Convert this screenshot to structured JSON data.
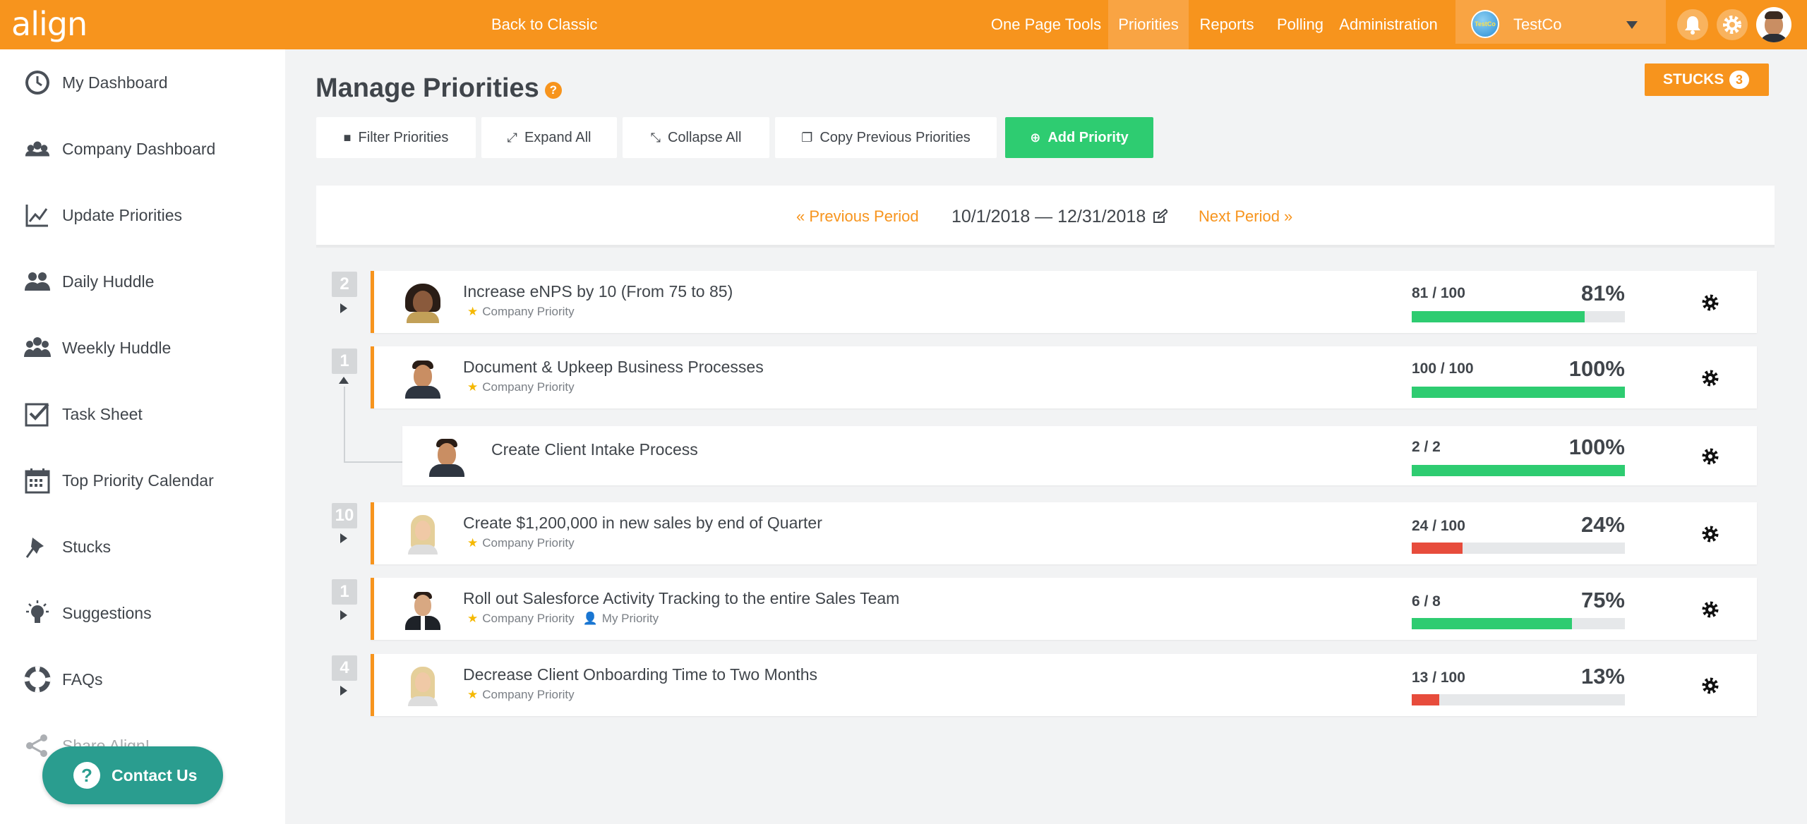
{
  "header": {
    "logo": "align",
    "back_to_classic": "Back to Classic",
    "nav": [
      "One Page Tools",
      "Priorities",
      "Reports",
      "Polling",
      "Administration"
    ],
    "active_nav": "Priorities",
    "company_logo_text": "TestCo",
    "company_name": "TestCo",
    "accent_color": "#f7941d"
  },
  "sidebar": {
    "items": [
      {
        "label": "My Dashboard",
        "icon": "dashboard-clock-icon"
      },
      {
        "label": "Company Dashboard",
        "icon": "team-icon"
      },
      {
        "label": "Update Priorities",
        "icon": "line-chart-icon"
      },
      {
        "label": "Daily Huddle",
        "icon": "group-icon"
      },
      {
        "label": "Weekly Huddle",
        "icon": "large-group-icon"
      },
      {
        "label": "Task Sheet",
        "icon": "checkbox-icon"
      },
      {
        "label": "Top Priority Calendar",
        "icon": "calendar-icon"
      },
      {
        "label": "Stucks",
        "icon": "pin-icon"
      },
      {
        "label": "Suggestions",
        "icon": "lightbulb-icon"
      },
      {
        "label": "FAQs",
        "icon": "lifebuoy-icon"
      },
      {
        "label": "Share Align!",
        "icon": "share-icon"
      }
    ],
    "contact_us": "Contact Us"
  },
  "main": {
    "title": "Manage Priorities",
    "help": "?",
    "stucks_label": "STUCKS",
    "stucks_count": "3",
    "toolbar": {
      "filter": "Filter Priorities",
      "expand": "Expand All",
      "collapse": "Collapse All",
      "copy": "Copy Previous Priorities",
      "add": "Add Priority"
    },
    "period": {
      "prev": "« Previous Period",
      "range": "10/1/2018 — 12/31/2018",
      "next": "Next Period »"
    },
    "priorities": [
      {
        "badge": "2",
        "title": "Increase eNPS by 10 (From 75 to 85)",
        "tag": "Company Priority",
        "tag2": "",
        "ratio": "81 / 100",
        "pct": "81%",
        "progress": 0.81,
        "status": "green"
      },
      {
        "badge": "1",
        "title": "Document & Upkeep Business Processes",
        "tag": "Company Priority",
        "tag2": "",
        "ratio": "100 / 100",
        "pct": "100%",
        "progress": 1.0,
        "status": "green"
      },
      {
        "badge": "",
        "title": "Create Client Intake Process",
        "tag": "",
        "tag2": "",
        "ratio": "2 / 2",
        "pct": "100%",
        "progress": 1.0,
        "status": "green"
      },
      {
        "badge": "10",
        "title": "Create $1,200,000 in new sales by end of Quarter",
        "tag": "Company Priority",
        "tag2": "",
        "ratio": "24 / 100",
        "pct": "24%",
        "progress": 0.24,
        "status": "red"
      },
      {
        "badge": "1",
        "title": "Roll out Salesforce Activity Tracking to the entire Sales Team",
        "tag": "Company Priority",
        "tag2": "My Priority",
        "ratio": "6 / 8",
        "pct": "75%",
        "progress": 0.75,
        "status": "green"
      },
      {
        "badge": "4",
        "title": "Decrease Client Onboarding Time to Two Months",
        "tag": "Company Priority",
        "tag2": "",
        "ratio": "13 / 100",
        "pct": "13%",
        "progress": 0.13,
        "status": "red"
      }
    ],
    "colors": {
      "green": "#2ecc71",
      "red": "#e74c3c"
    }
  }
}
